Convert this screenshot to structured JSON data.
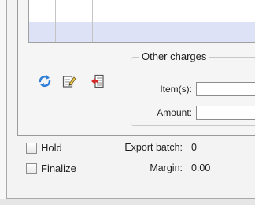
{
  "toolbar": {
    "icons": [
      "refresh-icon",
      "edit-note-icon",
      "import-list-icon"
    ],
    "refresh_color": "#2f7ed8"
  },
  "other_charges": {
    "title": "Other charges",
    "items_label": "Item(s):",
    "items_value": "",
    "amount_label": "Amount:",
    "amount_value": ""
  },
  "options": {
    "hold_label": "Hold",
    "hold_checked": false,
    "finalize_label": "Finalize",
    "finalize_checked": false
  },
  "summary": {
    "export_batch_label": "Export batch:",
    "export_batch_value": "0",
    "margin_label": "Margin:",
    "margin_value": "0.00"
  },
  "colors": {
    "selection": "#dde2f6",
    "background": "#f0f0f0"
  }
}
